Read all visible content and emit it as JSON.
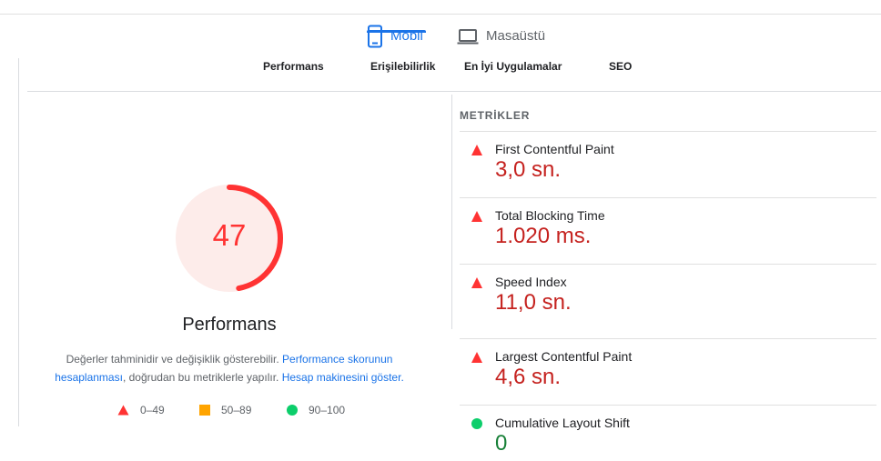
{
  "device_tabs": {
    "mobile": {
      "label": "Mobil",
      "icon": "smartphone-icon",
      "active": true
    },
    "desktop": {
      "label": "Masaüstü",
      "icon": "laptop-icon",
      "active": false
    }
  },
  "category_tabs": [
    {
      "label": "Performans"
    },
    {
      "label": "Erişilebilirlik"
    },
    {
      "label": "En İyi Uygulamalar"
    },
    {
      "label": "SEO"
    }
  ],
  "score": {
    "value": "47",
    "fraction": 0.47,
    "title": "Performans",
    "color": "#ff3333",
    "bg_color": "#fdecea"
  },
  "note": {
    "text1": "Değerler tahminidir ve değişiklik gösterebilir.",
    "link1": "Performance skorunun hesaplanması",
    "text2": ", doğrudan bu metriklerle yapılır.",
    "link2": "Hesap makinesini göster."
  },
  "legend": [
    {
      "range": "0–49",
      "shape": "triangle",
      "color": "#ff3333"
    },
    {
      "range": "50–89",
      "shape": "square",
      "color": "#ffa400"
    },
    {
      "range": "90–100",
      "shape": "circle",
      "color": "#0cce6b"
    }
  ],
  "metrics": {
    "heading": "METRİKLER",
    "items": [
      {
        "name": "First Contentful Paint",
        "value": "3,0 sn.",
        "status": "bad"
      },
      {
        "name": "Total Blocking Time",
        "value": "1.020 ms.",
        "status": "bad"
      },
      {
        "name": "Speed Index",
        "value": "11,0 sn.",
        "status": "bad"
      },
      {
        "name": "Largest Contentful Paint",
        "value": "4,6 sn.",
        "status": "bad"
      },
      {
        "name": "Cumulative Layout Shift",
        "value": "0",
        "status": "good"
      }
    ]
  },
  "colors": {
    "accent": "#1a73e8",
    "bad": "#c5221f",
    "good": "#188038"
  }
}
